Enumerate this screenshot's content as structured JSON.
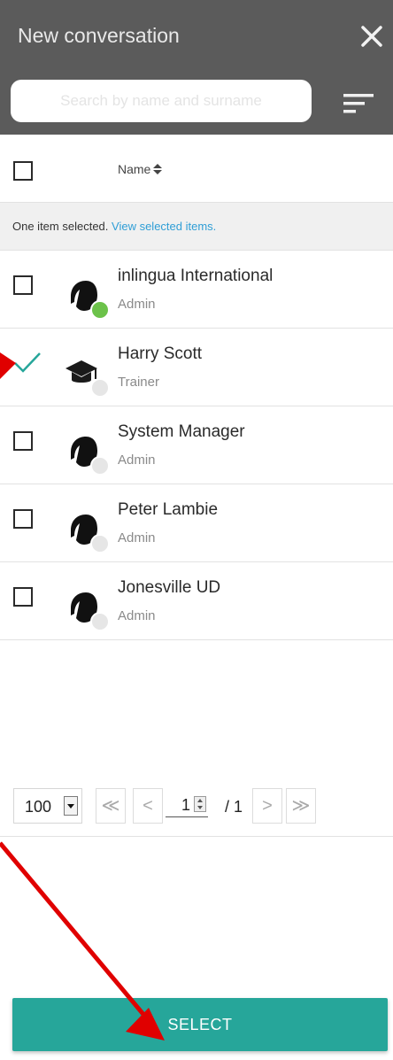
{
  "header": {
    "title": "New conversation",
    "search_placeholder": "Search by name and surname"
  },
  "table": {
    "name_column": "Name",
    "selection_text": "One item selected.",
    "selection_link": "View selected items."
  },
  "rows": [
    {
      "name": "inlingua International",
      "role": "Admin",
      "status": "online",
      "checked": false,
      "avatar": "logo"
    },
    {
      "name": "Harry Scott",
      "role": "Trainer",
      "status": "offline",
      "checked": true,
      "avatar": "graduation-cap"
    },
    {
      "name": "System Manager",
      "role": "Admin",
      "status": "offline",
      "checked": false,
      "avatar": "logo"
    },
    {
      "name": "Peter Lambie",
      "role": "Admin",
      "status": "offline",
      "checked": false,
      "avatar": "logo"
    },
    {
      "name": "Jonesville UD",
      "role": "Admin",
      "status": "offline",
      "checked": false,
      "avatar": "logo"
    }
  ],
  "pager": {
    "page_size": "100",
    "current_page": "1",
    "total": "/ 1",
    "first": "≪",
    "prev": "<",
    "next": ">",
    "last": "≫"
  },
  "footer": {
    "select_label": "SELECT"
  },
  "colors": {
    "header_bg": "#5b5b5b",
    "accent": "#26a69a",
    "link": "#2f9ed6",
    "online": "#6cc24a",
    "annotation": "#e00000"
  }
}
